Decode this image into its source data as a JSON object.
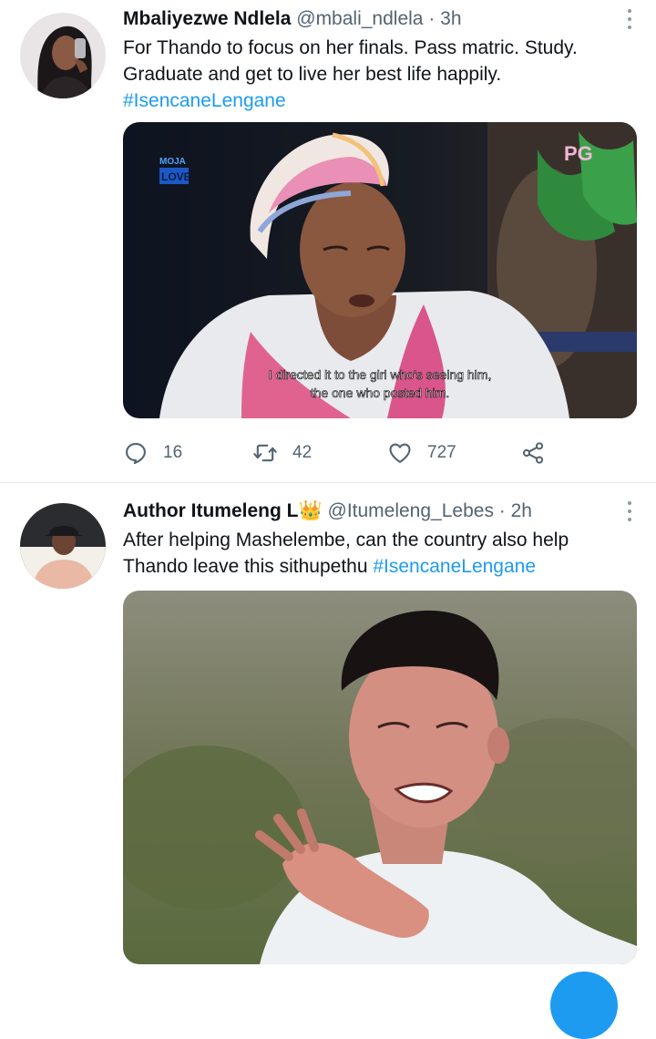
{
  "tweets": [
    {
      "name": "Mbaliyezwe Ndlela",
      "handle": "@mbali_ndlela",
      "separator": "·",
      "time": "3h",
      "text_lines": [
        "For Thando to focus on her finals. Pass matric. Study.",
        "Graduate and get to live her best life happily."
      ],
      "hashtag": "#IsencaneLengane",
      "media": {
        "channel_logo_top": "MOJA",
        "channel_logo_bottom": "LOVE",
        "rating": "PG",
        "subtitle_line_1": "I directed it to the girl who's seeing him,",
        "subtitle_line_2": "the one who posted him."
      },
      "actions": {
        "replies": "16",
        "retweets": "42",
        "likes": "727"
      }
    },
    {
      "name": "Author Itumeleng L",
      "name_emoji": "👑",
      "handle": "@Itumeleng_Lebes",
      "separator": "·",
      "time": "2h",
      "text_line_1": "After helping Mashelembe, can the country also help",
      "text_line_2_plain": "Thando leave this sithupethu ",
      "hashtag": "#IsencaneLengane"
    }
  ],
  "colors": {
    "link": "#1d9bf0",
    "muted": "#536471",
    "text": "#0f1419"
  }
}
